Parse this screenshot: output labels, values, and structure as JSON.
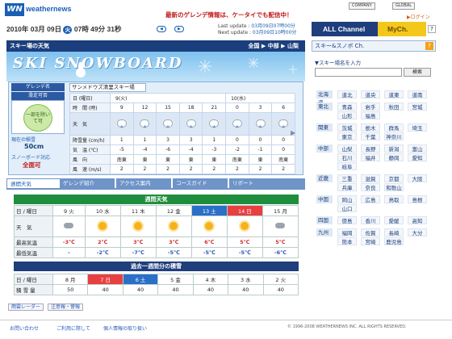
{
  "header": {
    "logo": "WN",
    "brand": "weathernews",
    "promo": "最新のゲレンデ情報は、ケータイでも配信中！",
    "company": "COMPANY",
    "global": "GLOBAL",
    "login": "▶ログイン"
  },
  "datebar": {
    "year": "2010年",
    "month": "03月",
    "day": "09日",
    "weekday": "火",
    "time": "07時 49分 31秒",
    "pill1": "◀",
    "pill2": "▶"
  },
  "update": {
    "last_label": "Last update",
    "last_value": "03月09日07時00分",
    "next_label": "Next update",
    "next_value": "03月09日10時00分"
  },
  "channel_tabs": {
    "all": "ALL Channel",
    "my": "MyCh.",
    "help": "?"
  },
  "main": {
    "bar_title": "スキー場の天気",
    "breadcrumb": "全国 ▶ 中部 ▶ 山梨",
    "banner_title": "SKI  SNOWBOARD",
    "resort_label": "ゲレンデ名",
    "resort_name": "サンメドウズ清里スキー場",
    "status_label": "滑走可否",
    "status_value": "一部を除いて可",
    "snow_depth_label": "現在の積雪",
    "snow_depth": "50cm",
    "snowboard_label": "スノーボード対応",
    "snowboard_value": "全面可"
  },
  "hourly": {
    "date_label": "日 (曜日)",
    "day1": "9(火)",
    "day2": "10(水)",
    "time_label": "時　間 (時)",
    "times": [
      "9",
      "12",
      "15",
      "18",
      "21",
      "0",
      "3",
      "6"
    ],
    "weather_label": "天　気",
    "precip_label": "降雪量 (cm/h)",
    "precip": [
      "1",
      "1",
      "3",
      "3",
      "1",
      "0",
      "0",
      "0"
    ],
    "temp_label": "気　温 (℃)",
    "temps": [
      "-5",
      "-4",
      "-6",
      "-4",
      "-3",
      "-2",
      "-1",
      "0"
    ],
    "winddir_label": "風　向",
    "winddir": [
      "南東",
      "東",
      "東",
      "東",
      "東",
      "南東",
      "東",
      "南東"
    ],
    "windspeed_label": "風　速 (m/s)",
    "windspeed": [
      "2",
      "2",
      "2",
      "2",
      "2",
      "2",
      "2",
      "2"
    ]
  },
  "tabs": [
    "週間天気",
    "ゲレンデ紹介",
    "アクセス案内",
    "コースガイド",
    "リポート"
  ],
  "weekly": {
    "title": "週間天気",
    "day_label": "日 / 曜日",
    "days": [
      "9 火",
      "10 水",
      "11 木",
      "12 金",
      "13 土",
      "14 日",
      "15 月"
    ],
    "weather_label": "天　気",
    "high_label": "最高気温",
    "highs": [
      "-3℃",
      "2℃",
      "3℃",
      "3℃",
      "6℃",
      "5℃",
      "5℃"
    ],
    "low_label": "最低気温",
    "lows": [
      "-",
      "-2℃",
      "-7℃",
      "-5℃",
      "-5℃",
      "-5℃",
      "-6℃"
    ]
  },
  "snowfall": {
    "title": "過去一週間分の積雪",
    "day_label": "日 / 曜日",
    "days": [
      "8 月",
      "7 日",
      "6 土",
      "5 金",
      "4 木",
      "3 水",
      "2 火"
    ],
    "amount_label": "積 雪 量",
    "amounts": [
      "50",
      "40",
      "40",
      "40",
      "40",
      "40",
      "40"
    ]
  },
  "legend": {
    "radar": "雨雲レーダー",
    "warning": "注意報・警報"
  },
  "right_panel": {
    "title": "スキー&スノボ Ch.",
    "help": "?",
    "search_label": "▼スキー場名を入力",
    "search_placeholder": "",
    "search_button": "検索",
    "regions": [
      {
        "name": "北海道",
        "cells": [
          "道北",
          "道央",
          "道東",
          "道南"
        ]
      },
      {
        "name": "東北",
        "cells": [
          "青森",
          "岩手",
          "秋田",
          "宮城"
        ]
      },
      {
        "name": "",
        "cells": [
          "山形",
          "福島"
        ]
      },
      {
        "name": "関東",
        "cells": [
          "茨城",
          "栃木",
          "群馬",
          "埼玉"
        ]
      },
      {
        "name": "",
        "cells": [
          "東京",
          "千葉",
          "神奈川"
        ]
      },
      {
        "name": "中部",
        "cells": [
          "山梨",
          "長野",
          "新潟",
          "富山"
        ]
      },
      {
        "name": "",
        "cells": [
          "石川",
          "福井",
          "静岡",
          "愛知"
        ]
      },
      {
        "name": "",
        "cells": [
          "岐阜"
        ]
      },
      {
        "name": "近畿",
        "cells": [
          "三重",
          "滋賀",
          "京都",
          "大阪"
        ]
      },
      {
        "name": "",
        "cells": [
          "兵庫",
          "奈良",
          "和歌山"
        ]
      },
      {
        "name": "中国",
        "cells": [
          "岡山",
          "広島",
          "鳥取",
          "島根"
        ]
      },
      {
        "name": "",
        "cells": [
          "山口"
        ]
      },
      {
        "name": "四国",
        "cells": [
          "徳島",
          "香川",
          "愛媛",
          "高知"
        ]
      },
      {
        "name": "九州",
        "cells": [
          "福岡",
          "佐賀",
          "長崎",
          "大分"
        ]
      },
      {
        "name": "",
        "cells": [
          "熊本",
          "宮崎",
          "鹿児島"
        ]
      }
    ]
  },
  "footer": {
    "links": [
      "お問い合わせ",
      "ご利用に際して",
      "個人情報の取り扱い"
    ],
    "copyright": "© 1996-2008 WEATHERNEWS INC. ALL RIGHTS RESERVED."
  },
  "colors": {
    "brand": "#1a5fb4",
    "header_bar": "#1b3f7c",
    "weekly_green": "#1e8e3e",
    "sun_red": "#e84040",
    "sat_blue": "#2a6fc8"
  }
}
